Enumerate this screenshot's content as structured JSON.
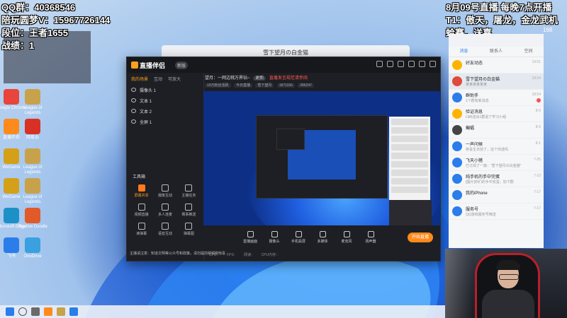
{
  "overlay_left": {
    "qq_group": "QQ群：40368546",
    "companion": "陪玩圆梦V：15967726144",
    "rank": "段位：王者1655",
    "record": "战绩：1"
  },
  "overlay_right": {
    "schedule": "8月09号直播  每晚7点开播",
    "t1": "T1：傲天，屠龙，金龙武机",
    "t2": "蛤赛，送嘉"
  },
  "viewer_count": "168",
  "desktop_icons": [
    {
      "label": "Google Chrome",
      "color": "#e8453c"
    },
    {
      "label": "League of Legends",
      "color": "#c8a24a"
    },
    {
      "label": "直播伴侣",
      "color": "#ff8a1c"
    },
    {
      "label": "网易云",
      "color": "#d93025"
    },
    {
      "label": "WeGame",
      "color": "#d4a017"
    },
    {
      "label": "League of Legends",
      "color": "#c8a24a"
    },
    {
      "label": "WeGame",
      "color": "#d4a017"
    },
    {
      "label": "League of Legends",
      "color": "#c8a24a"
    },
    {
      "label": "Microsoft Edge",
      "color": "#1e90c8"
    },
    {
      "label": "Skydive Doodle",
      "color": "#e05a2a"
    },
    {
      "label": "飞书",
      "color": "#2b7de9"
    },
    {
      "label": "OneDrive",
      "color": "#3aa0e0"
    }
  ],
  "bg_window_title": "雪下望月の白金猫",
  "app": {
    "logo": "直播伴侣",
    "version": "新版",
    "tabs": [
      "我的场景",
      "互动",
      "可放大"
    ],
    "scenes": [
      "摄像头 1",
      "文本 1",
      "文本 2",
      "全屏 1"
    ],
    "toolbox_title": "工具箱",
    "tools": [
      "屏幕共享",
      "摄像互动",
      "主播任务",
      "视频直播",
      "多人连麦",
      "赛事推送",
      "读弹幕",
      "语音互动",
      "弹幕图"
    ],
    "room_title": "望月：一网边桃万界钻~",
    "room_tag": "更新",
    "room_alert": "直播发言规范请参阅",
    "room_stats": [
      "19万粉丝活跃",
      "今日直播",
      "雪下望月",
      "1871156",
      "286247"
    ],
    "controls": [
      "直播画面",
      "摄像头",
      "手机投屏",
      "多媒体",
      "麦克风",
      "扬声器"
    ],
    "live_button": "开始直播",
    "notice": "主播请注意：知道文明等公众号和政策，请勿提前频频刷惊喜",
    "status": [
      "CPU：",
      "FPS：",
      "网速：",
      "CPU内存："
    ]
  },
  "qq": {
    "tabs": [
      "消息",
      "联系人",
      "空间"
    ],
    "items": [
      {
        "name": "好友动态",
        "msg": "",
        "time": "19:51",
        "color": "#ffb300",
        "badge": false
      },
      {
        "name": "雪下望月の白金猫",
        "msg": "某某某某某某",
        "time": "19:24",
        "color": "#e04a3a",
        "badge": false
      },
      {
        "name": "群助手",
        "msg": "1个群有新消息",
        "time": "18:54",
        "color": "#2b7de9",
        "badge": true
      },
      {
        "name": "验证消息",
        "msg": "LBB送出1群退了学习小组",
        "time": "8-5",
        "color": "#ffb300",
        "badge": false
      },
      {
        "name": "蝙蝠",
        "msg": "",
        "time": "8-5",
        "color": "#444444",
        "badge": false
      },
      {
        "name": "一声问候",
        "msg": "恭喜生日前了，这个你送吗",
        "time": "8-1",
        "color": "#2b7de9",
        "badge": false
      },
      {
        "name": "飞天小猪",
        "msg": "已订阅了一篇：“雪下望月の白金猫”",
        "time": "7-25",
        "color": "#2b7de9",
        "badge": false
      },
      {
        "name": "纯手机的手中完蛋",
        "msg": "[图片]你们的手中完蛋，加下群",
        "time": "7-23",
        "color": "#2b7de9",
        "badge": false
      },
      {
        "name": "我的iPhone",
        "msg": "",
        "time": "7-17",
        "color": "#2b7de9",
        "badge": false
      },
      {
        "name": "服务号",
        "msg": "QQ游戏服务号推送",
        "time": "7-17",
        "color": "#2b7de9",
        "badge": false
      }
    ]
  }
}
